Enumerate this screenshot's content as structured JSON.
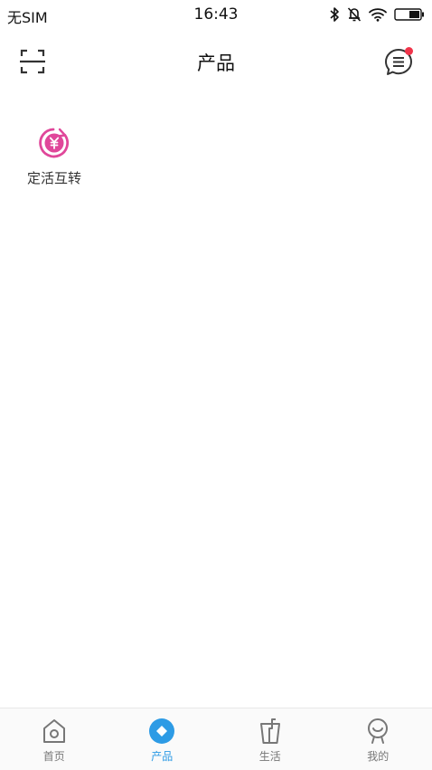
{
  "status_bar": {
    "carrier": "无SIM",
    "time": "16:43",
    "icons": [
      "bluetooth-icon",
      "mute-bell-icon",
      "wifi-icon",
      "battery-icon"
    ]
  },
  "nav": {
    "title": "产品",
    "left_icon": "scan-icon",
    "right_icon": "message-icon",
    "message_badge_color": "#f0344a"
  },
  "products": [
    {
      "label": "定活互转",
      "icon": "yuan-transfer-icon",
      "color": "#e0479a"
    }
  ],
  "tab_bar": {
    "active_color": "#2d9be5",
    "inactive_color": "#777777",
    "tabs": [
      {
        "label": "首页",
        "icon": "home-icon",
        "active": false
      },
      {
        "label": "产品",
        "icon": "product-diamond-icon",
        "active": true
      },
      {
        "label": "生活",
        "icon": "life-cup-icon",
        "active": false
      },
      {
        "label": "我的",
        "icon": "profile-icon",
        "active": false
      }
    ]
  }
}
